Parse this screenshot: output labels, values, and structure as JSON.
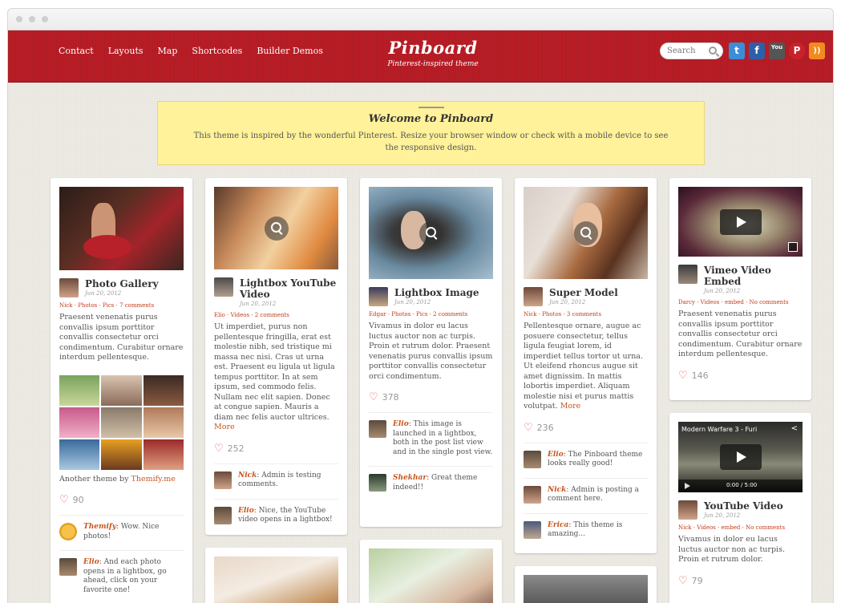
{
  "nav": {
    "items": [
      "Contact",
      "Layouts",
      "Map",
      "Shortcodes",
      "Builder Demos"
    ]
  },
  "site": {
    "title": "Pinboard",
    "tagline": "Pinterest-inspired theme"
  },
  "search": {
    "placeholder": "Search"
  },
  "social": [
    {
      "name": "twitter-icon",
      "glyph": "t",
      "color": "#3a8dd6"
    },
    {
      "name": "facebook-icon",
      "glyph": "f",
      "color": "#2f5fa8"
    },
    {
      "name": "youtube-icon",
      "glyph": "You",
      "color": "#555555"
    },
    {
      "name": "pinterest-icon",
      "glyph": "P",
      "color": "#c8232c"
    },
    {
      "name": "rss-icon",
      "glyph": "))",
      "color": "#f28a1e"
    }
  ],
  "welcome": {
    "title": "Welcome to Pinboard",
    "text": "This theme is inspired by the wonderful Pinterest. Resize your browser window or check with a mobile device to see the responsive design."
  },
  "posts": [
    {
      "title": "Photo Gallery",
      "date": "Jun 20, 2012",
      "meta": "Nick · Photos · Pics · 7 comments",
      "excerpt": "Praesent venenatis purus convallis ipsum porttitor convallis consectetur orci condimentum. Curabitur ornare interdum pellentesque.",
      "footer_text": "Another theme by ",
      "footer_link": "Themify.me",
      "likes": "90",
      "comments": [
        {
          "author": "Themify",
          "text": ": Wow. Nice photos!"
        },
        {
          "author": "Elio",
          "text": ": And each photo opens in a lightbox, go ahead, click on your favorite one!"
        }
      ]
    },
    {
      "title": "Lightbox YouTube Video",
      "date": "Jun 20, 2012",
      "meta": "Elio · Videos · 2 comments",
      "excerpt": "Ut imperdiet, purus non pellentesque fringilla, erat est molestie nibh, sed tristique mi massa nec nisi. Cras ut urna est. Praesent eu ligula ut ligula tempus porttitor. In at sem ipsum, sed commodo felis. Nullam nec elit sapien. Donec at congue sapien. Mauris a diam nec felis auctor ultrices.",
      "more": "More",
      "likes": "252",
      "comments": [
        {
          "author": "Nick",
          "text": ": Admin is testing comments."
        },
        {
          "author": "Elio",
          "text": ": Nice, the YouTube video opens in a lightbox!"
        }
      ]
    },
    {
      "title": "Lightbox Image",
      "date": "Jun 20, 2012",
      "meta": "Edgar · Photos · Pics · 2 comments",
      "excerpt": "Vivamus in dolor eu lacus luctus auctor non ac turpis. Proin et rutrum dolor. Praesent venenatis purus convallis ipsum porttitor convallis consectetur orci condimentum.",
      "likes": "378",
      "comments": [
        {
          "author": "Elio",
          "text": ": This image is launched in a lightbox, both in the post list view and in the single post view."
        },
        {
          "author": "Shekhar",
          "text": ": Great theme indeed!!"
        }
      ]
    },
    {
      "title": "Super Model",
      "date": "Jun 20, 2012",
      "meta": "Nick · Photos · 3 comments",
      "excerpt": "Pellentesque ornare, augue ac posuere consectetur, tellus ligula feugiat lorem, id imperdiet tellus tortor ut urna. Ut eleifend rhoncus augue sit amet dignissim. In mattis lobortis imperdiet. Aliquam molestie nisi et purus mattis volutpat.",
      "more": "More",
      "likes": "236",
      "comments": [
        {
          "author": "Elio",
          "text": ": The Pinboard theme looks really good!"
        },
        {
          "author": "Nick",
          "text": ": Admin is posting a comment here."
        },
        {
          "author": "Erica",
          "text": ": This theme is amazing..."
        }
      ]
    },
    {
      "title": "Vimeo Video Embed",
      "date": "Jun 20, 2012",
      "meta": "Darcy · Videos · embed · No comments",
      "excerpt": "Praesent venenatis purus convallis ipsum porttitor convallis consectetur orci condimentum. Curabitur ornare interdum pellentesque.",
      "likes": "146"
    },
    {
      "title": "YouTube Video",
      "date": "Jun 20, 2012",
      "meta": "Nick · Videos · embed · No comments",
      "excerpt": "Vivamus in dolor eu lacus luctus auctor non ac turpis. Proin et rutrum dolor.",
      "likes": "79",
      "video_title": "Modern Warfare 3 - Furi",
      "video_time": "0:00 / 5:00"
    }
  ]
}
